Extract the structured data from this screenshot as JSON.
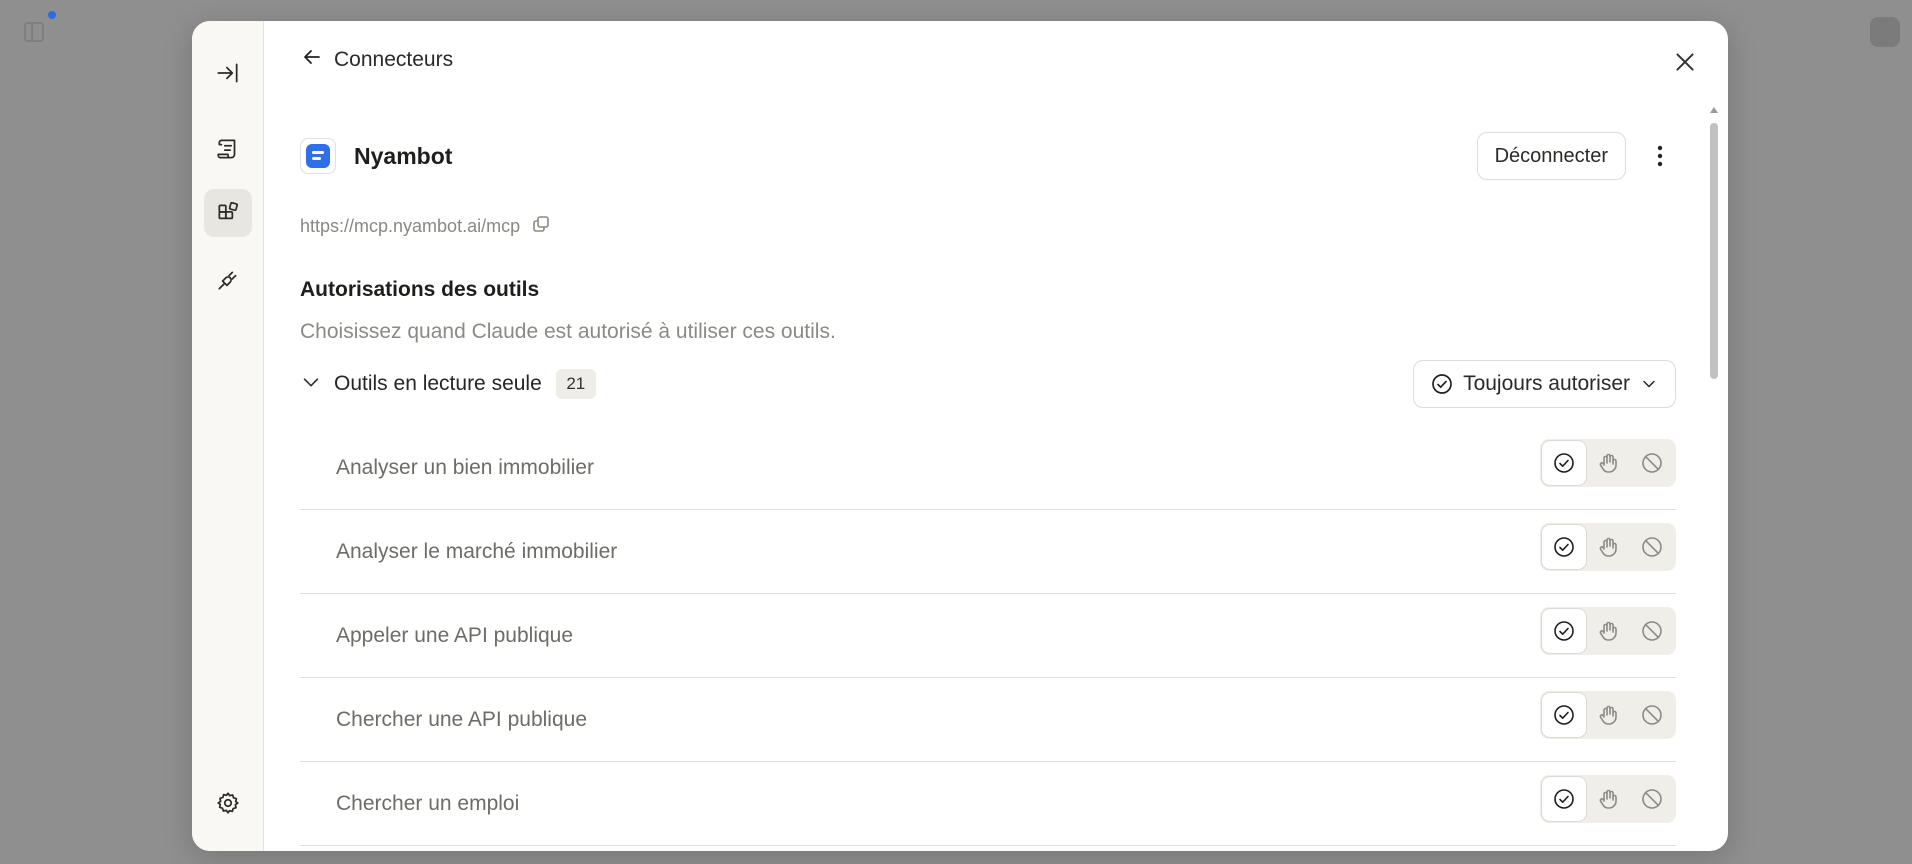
{
  "colors": {
    "accent": "#2f6fe8",
    "overlay": "#8f8f8f",
    "muted_text": "#8c8a84"
  },
  "rail": {
    "items": [
      {
        "icon": "collapse-panel-icon"
      },
      {
        "icon": "scroll-document-icon"
      },
      {
        "icon": "connectors-icon",
        "active": true
      },
      {
        "icon": "plug-icon"
      },
      {
        "icon": "gear-icon"
      }
    ]
  },
  "header": {
    "back_icon": "arrow-left-icon",
    "title": "Connecteurs",
    "close_icon": "close-icon"
  },
  "connector": {
    "name": "Nyambot",
    "url": "https://mcp.nyambot.ai/mcp",
    "disconnect_label": "Déconnecter",
    "more_icon": "more-vertical-icon"
  },
  "permissions": {
    "title": "Autorisations des outils",
    "description": "Choisissez quand Claude est autorisé à utiliser ces outils.",
    "group": {
      "label": "Outils en lecture seule",
      "count": "21",
      "policy": "Toujours autoriser"
    },
    "tools": [
      {
        "name": "Analyser un bien immobilier",
        "selected": "allow"
      },
      {
        "name": "Analyser le marché immobilier",
        "selected": "allow"
      },
      {
        "name": "Appeler une API publique",
        "selected": "allow"
      },
      {
        "name": "Chercher une API publique",
        "selected": "allow"
      },
      {
        "name": "Chercher un emploi",
        "selected": "allow"
      }
    ]
  }
}
